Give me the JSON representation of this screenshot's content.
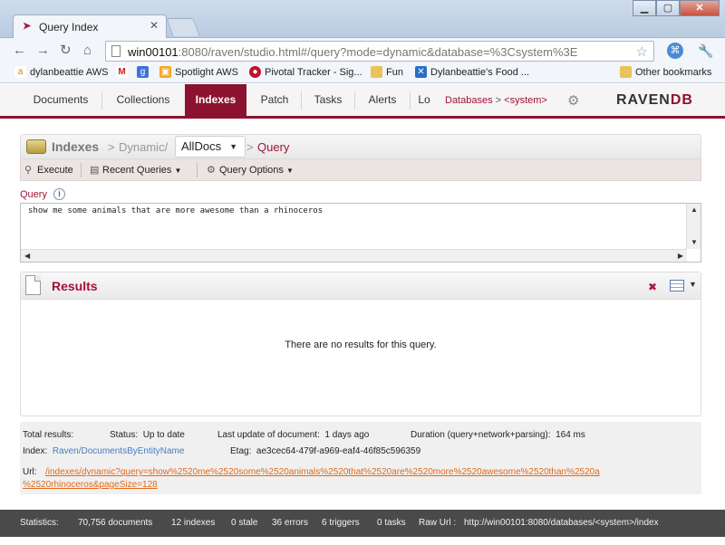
{
  "browser": {
    "tab_title": "Query Index",
    "url_host": "win00101",
    "url_rest": ":8080/raven/studio.html#/query?mode=dynamic&database=%3Csystem%3E",
    "bookmarks": [
      {
        "label": "dylanbeattie AWS",
        "icon": "amazon-icon"
      },
      {
        "label": "",
        "icon": "gmail-icon"
      },
      {
        "label": "",
        "icon": "google-icon"
      },
      {
        "label": "Spotlight AWS",
        "icon": "aws-icon"
      },
      {
        "label": "Pivotal Tracker - Sig...",
        "icon": "pivotal-icon"
      },
      {
        "label": "Fun",
        "icon": "folder-icon"
      },
      {
        "label": "Dylanbeattie's Food ...",
        "icon": "bookmark-icon"
      }
    ],
    "other_bookmarks": "Other bookmarks"
  },
  "nav": {
    "items": [
      "Documents",
      "Collections",
      "Indexes",
      "Patch",
      "Tasks",
      "Alerts",
      "Lo"
    ],
    "active": "Indexes",
    "databases_label": "Databases",
    "db_sep": ">",
    "current_db": "<system>",
    "logo_raven": "RAVEN",
    "logo_db": "DB"
  },
  "page": {
    "section": "Indexes",
    "crumb_sep": ">",
    "crumb_dynamic": "Dynamic/",
    "index_select": "AllDocs",
    "crumb_query": "Query",
    "commands": {
      "execute": "Execute",
      "recent_queries": "Recent Queries",
      "query_options": "Query Options"
    },
    "query_label": "Query",
    "query_text": "show me some animals that are more awesome than a rhinoceros"
  },
  "results": {
    "title": "Results",
    "empty_message": "There are no results for this query."
  },
  "status": {
    "total_results_label": "Total results:",
    "status_label": "Status:",
    "status_value": "Up to date",
    "last_update_label": "Last update of document:",
    "last_update_value": "1 days ago",
    "duration_label": "Duration (query+network+parsing):",
    "duration_value": "164 ms",
    "index_label": "Index:",
    "index_value": "Raven/DocumentsByEntityName",
    "etag_label": "Etag:",
    "etag_value": "ae3cec64-479f-a969-eaf4-46f85c596359",
    "url_label": "Url:",
    "url_line1": "/indexes/dynamic?query=show%2520me%2520some%2520animals%2520that%2520are%2520more%2520awesome%2520than%2520a",
    "url_line2": "%2520rhinoceros&pageSize=128"
  },
  "footer": {
    "statistics_label": "Statistics:",
    "documents": "70,756 documents",
    "indexes": "12 indexes",
    "stale": "0 stale",
    "errors": "36 errors",
    "triggers": "6 triggers",
    "tasks": "0 tasks",
    "raw_url_label": "Raw Url :",
    "raw_url": "http://win00101:8080/databases/<system>/index"
  }
}
